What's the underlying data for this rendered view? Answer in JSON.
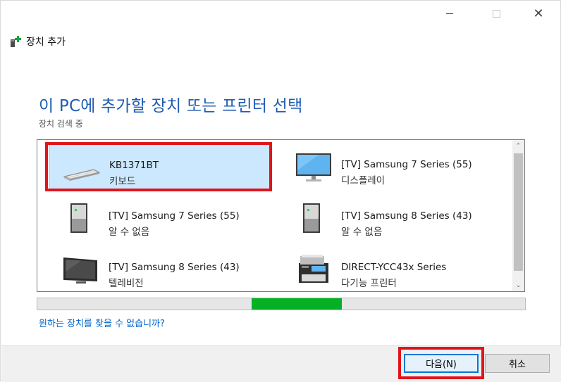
{
  "window": {
    "title": "장치 추가",
    "controls": {
      "minimize": "—",
      "maximize": "☐",
      "close": "✕"
    }
  },
  "heading": "이 PC에 추가할 장치 또는 프린터 선택",
  "status": "장치 검색 중",
  "devices": [
    {
      "name": "KB1371BT",
      "type": "키보드",
      "icon": "keyboard-icon",
      "selected": true
    },
    {
      "name": "[TV] Samsung 7 Series (55)",
      "type": "디스플레이",
      "icon": "monitor-icon",
      "selected": false
    },
    {
      "name": "[TV] Samsung 7 Series (55)",
      "type": "알 수 없음",
      "icon": "unknown-device-icon",
      "selected": false
    },
    {
      "name": "[TV] Samsung 8 Series (43)",
      "type": "알 수 없음",
      "icon": "unknown-device-icon",
      "selected": false
    },
    {
      "name": "[TV] Samsung 8 Series (43)",
      "type": "텔레비전",
      "icon": "television-icon",
      "selected": false
    },
    {
      "name": "DIRECT-YCC43x Series",
      "type": "다기능 프린터",
      "icon": "printer-icon",
      "selected": false
    }
  ],
  "scrollbar": {
    "up": "⌃",
    "down": "⌄"
  },
  "progress": {
    "indeterminate_fill_start": 0.44,
    "indeterminate_fill_end": 0.625
  },
  "help_link": "원하는 장치를 찾을 수 없습니까?",
  "buttons": {
    "next": "다음(N)",
    "cancel": "취소"
  },
  "colors": {
    "heading": "#1f5cb0",
    "link": "#0066cc",
    "progress": "#06b025",
    "highlight": "#e0151c",
    "selection": "#cce8ff"
  }
}
